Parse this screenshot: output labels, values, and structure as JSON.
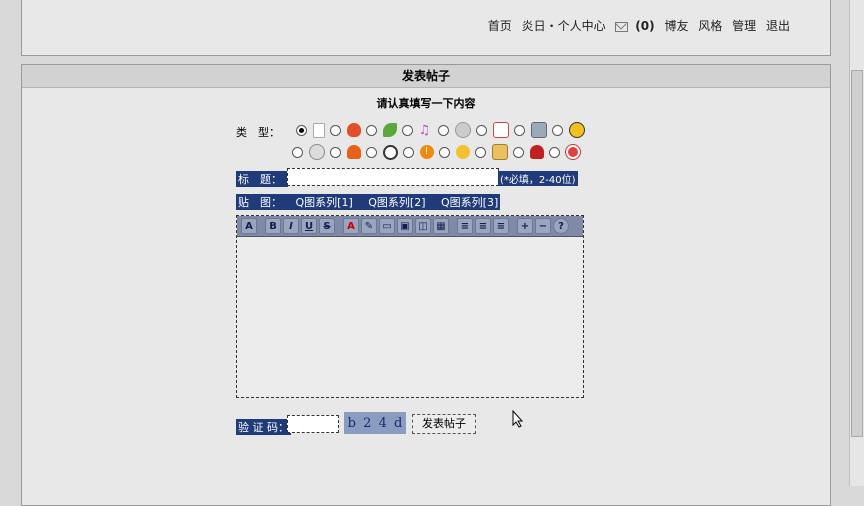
{
  "top_nav": {
    "home": "首页",
    "user": "炎日・个人中心",
    "mail_count": "(0)",
    "blog": "博友",
    "style": "风格",
    "manage": "管理",
    "logout": "退出"
  },
  "panel": {
    "header": "发表帖子",
    "subtitle": "请认真填写一下内容"
  },
  "form": {
    "type_label": "类　型：",
    "title_label": "标　题：",
    "title_hint": "(*必填，2-40位)",
    "image_label": "贴　图：",
    "image_links": [
      "Q图系列[1]",
      "Q图系列[2]",
      "Q图系列[3]"
    ],
    "captcha_label": "验 证 码：",
    "captcha_text": [
      "b",
      "2",
      "4",
      "d"
    ],
    "submit_label": "发表帖子"
  },
  "colors": {
    "highlight_bg": "#1f3b7a",
    "toolbar_bg": "#7f8ba6"
  },
  "type_icons_row1": [
    "radio-selected",
    "document-icon",
    "heart-icon",
    "leaf-icon",
    "music-icon",
    "cd-icon",
    "card-icon",
    "camera-icon",
    "radiation-icon"
  ],
  "type_icons_row2": [
    "play-icon",
    "fire-icon",
    "soccer-icon",
    "exclamation-icon",
    "sun-icon",
    "scroll-icon",
    "rose-icon",
    "lifebuoy-icon"
  ],
  "toolbar_buttons": [
    "A",
    "B",
    "I",
    "U",
    "S",
    "A",
    "✎",
    "▭",
    "▣",
    "◫",
    "▦",
    "≡",
    "≡",
    "≡",
    "+",
    "−",
    "?"
  ]
}
